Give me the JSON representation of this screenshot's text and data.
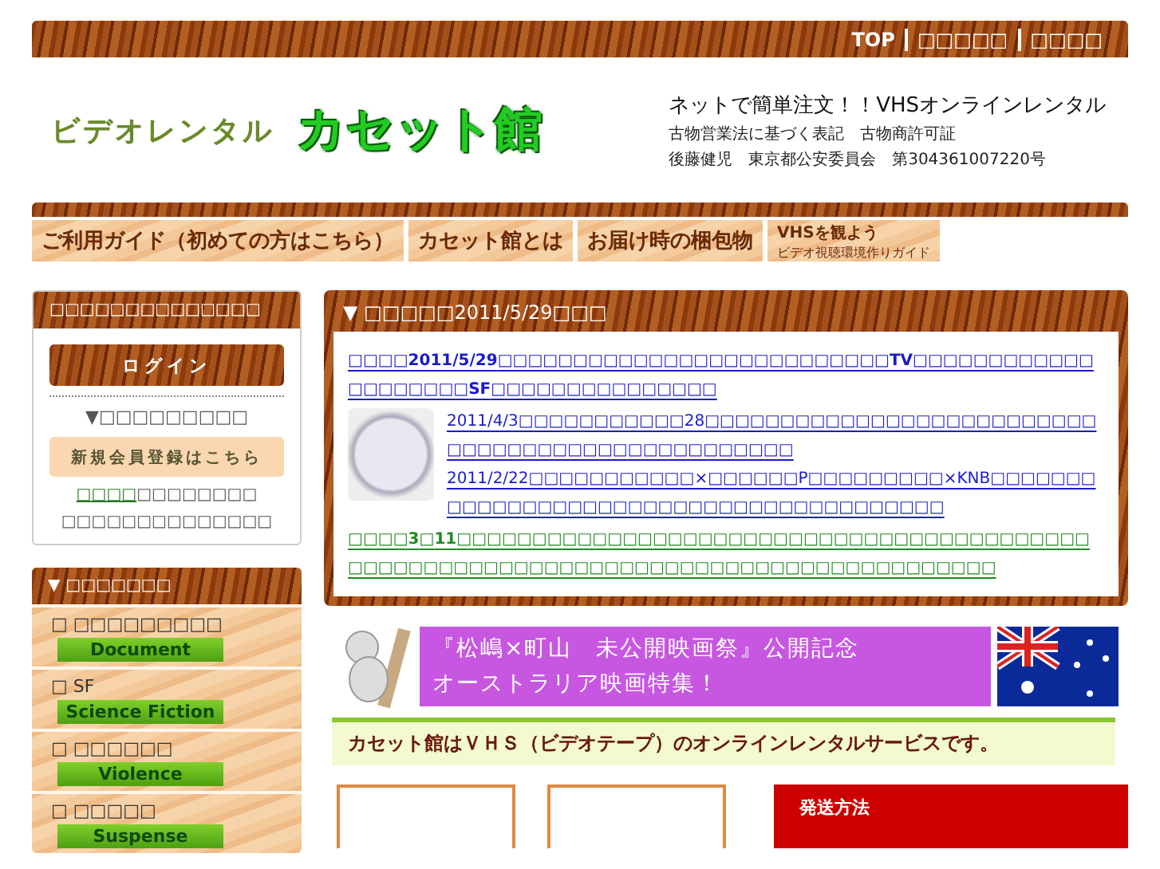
{
  "top_links": [
    "TOP",
    "□□□□□",
    "□□□□"
  ],
  "header": {
    "logo_small": "ビデオレンタル",
    "logo_big": "カセット館",
    "catch": "ネットで簡単注文！！VHSオンラインレンタル",
    "license_lines": [
      "古物営業法に基づく表記　古物商許可証",
      "後藤健児　東京都公安委員会　第304361007220号"
    ]
  },
  "nav": [
    {
      "label": "ご利用ガイド（初めての方はこちら）"
    },
    {
      "label": "カセット館とは"
    },
    {
      "label": "お届け時の梱包物"
    },
    {
      "label": "VHSを観よう",
      "sub": "ビデオ視聴環境作りガイド"
    }
  ],
  "member_box": {
    "title": "□□□□□□□□□□□□□□",
    "login": "ログイン",
    "note": "▼□□□□□□□□□",
    "register": "新規会員登録はこちら",
    "link": "□□□□",
    "link_after": "□□□□□□□□",
    "line": "□□□□□□□□□□□□□□"
  },
  "categories": {
    "title": "▼ □□□□□□□",
    "items": [
      {
        "icon": "□",
        "name": "□□□□□□□□□",
        "tag": "Document"
      },
      {
        "icon": "□",
        "name": "SF",
        "tag": "Science Fiction"
      },
      {
        "icon": "□",
        "name": "□□□□□□",
        "tag": "Violence"
      },
      {
        "icon": "□",
        "name": "□□□□□",
        "tag": "Suspense"
      }
    ]
  },
  "news": {
    "title": "▼ □□□□□2011/5/29□□□",
    "lead": "□□□□**2011/5/29**□□□□□□□□□□□□□□□□□□□□□□□□□□**TV**□□□□□□□□□□□□□□□□□□□□**SF**□□□□□□□□□□□□□□□",
    "thumb_items": [
      "2011/4/3□□□□□□□□□□□28□□□□□□□□□□□□□□□□□□□□□□□□□□□□□□□□□□□□□□□□□□□□□□□□□",
      "2011/2/22□□□□□□□□□□□×□□□□□□P□□□□□□□□□×KNB□□□□□□□□□□□□□□□□□□□□□□□□□□□□□□□□□□□□□□□□"
    ],
    "notice": "□□□□**3**□**11**□□□□□□□□□□□□□□□□□□□□□□□□□□□□□□□□□□□□□□□□□□□□□□□□□□□□□□□□□□□□□□□□□□□□□□□□□□□□□□□□□□□□□"
  },
  "promo": {
    "lines": [
      "『松嶋×町山　未公開映画祭』公開記念",
      "オーストラリア映画特集！"
    ]
  },
  "tagline": "カセット館はＶＨＳ（ビデオテープ）のオンラインレンタルサービスです。",
  "shipping": {
    "title": "発送方法"
  }
}
